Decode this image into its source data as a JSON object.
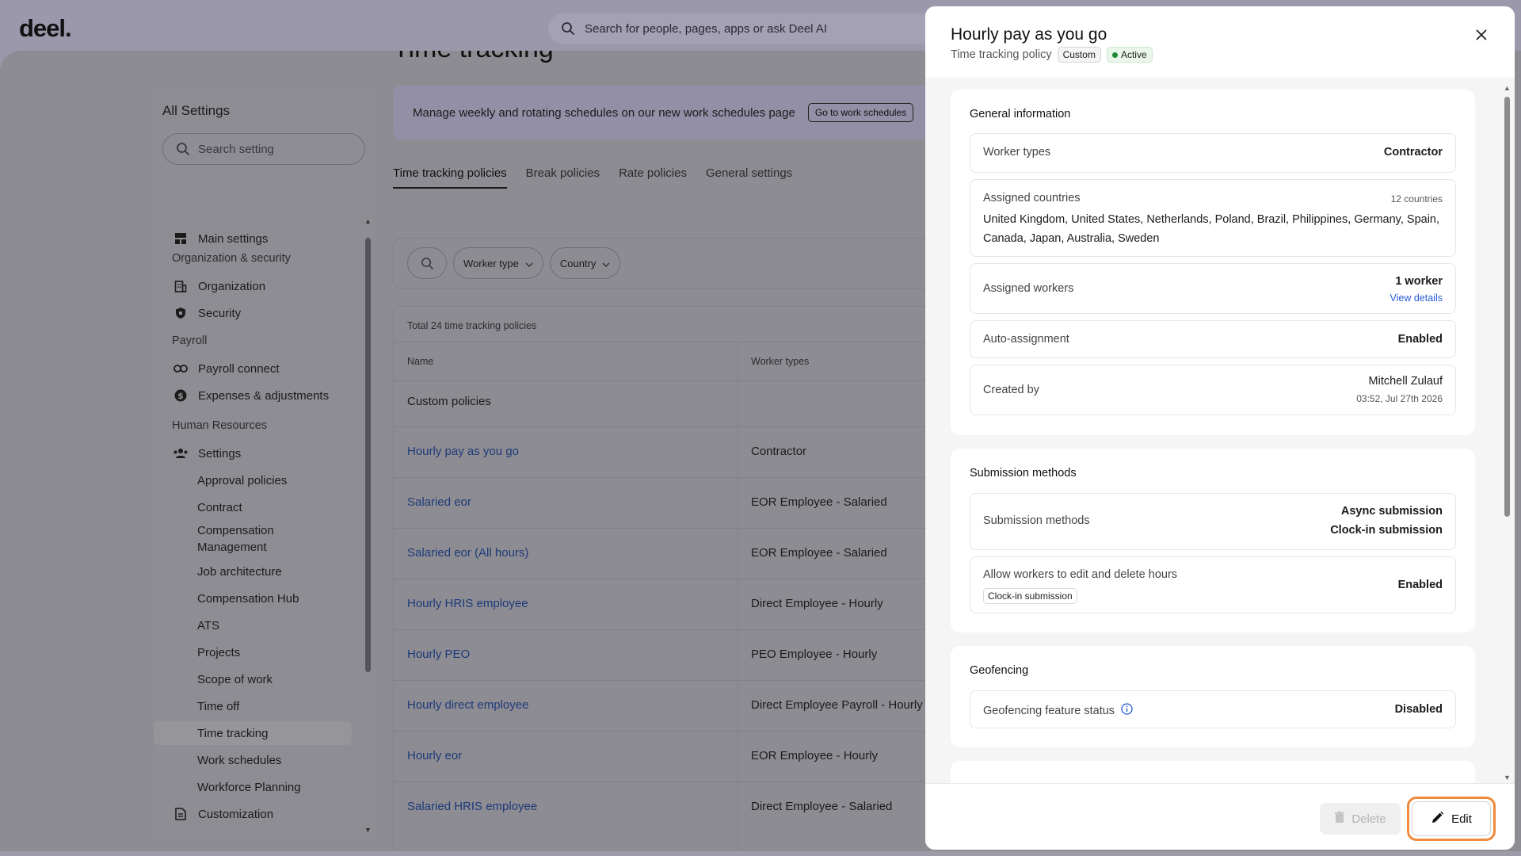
{
  "app": {
    "logo": "deel.",
    "search_placeholder": "Search for people, pages, apps or ask Deel AI"
  },
  "page": {
    "title": "Time tracking"
  },
  "sidebar": {
    "title": "All Settings",
    "search_placeholder": "Search setting",
    "main_settings": "Main settings",
    "sections": {
      "org_security": "Organization & security",
      "payroll": "Payroll",
      "hr": "Human Resources"
    },
    "items": {
      "organization": "Organization",
      "security": "Security",
      "payroll_connect": "Payroll connect",
      "expenses": "Expenses & adjustments",
      "settings": "Settings",
      "approval_policies": "Approval policies",
      "contract": "Contract",
      "compensation_management": "Compensation Management",
      "job_architecture": "Job architecture",
      "compensation_hub": "Compensation Hub",
      "ats": "ATS",
      "projects": "Projects",
      "scope_of_work": "Scope of work",
      "time_off": "Time off",
      "time_tracking": "Time tracking",
      "work_schedules": "Work schedules",
      "workforce_planning": "Workforce Planning",
      "customization": "Customization"
    }
  },
  "banner": {
    "text": "Manage weekly and rotating schedules on our new work schedules page",
    "button": "Go to work schedules"
  },
  "tabs": [
    "Time tracking policies",
    "Break policies",
    "Rate policies",
    "General settings"
  ],
  "filters": {
    "worker_type": "Worker type",
    "country": "Country"
  },
  "table": {
    "total": "Total 24 time tracking policies",
    "headers": {
      "name": "Name",
      "worker_types": "Worker types"
    },
    "group": "Custom policies",
    "rows": [
      {
        "name": "Hourly pay as you go",
        "worker_type": "Contractor"
      },
      {
        "name": "Salaried eor",
        "worker_type": "EOR Employee - Salaried"
      },
      {
        "name": "Salaried eor (All hours)",
        "worker_type": "EOR Employee - Salaried"
      },
      {
        "name": "Hourly HRIS employee",
        "worker_type": "Direct Employee - Hourly"
      },
      {
        "name": "Hourly PEO",
        "worker_type": "PEO Employee - Hourly"
      },
      {
        "name": "Hourly direct employee",
        "worker_type": "Direct Employee Payroll - Hourly"
      },
      {
        "name": "Hourly eor",
        "worker_type": "EOR Employee - Hourly"
      },
      {
        "name": "Salaried HRIS employee",
        "worker_type": "Direct Employee - Salaried"
      }
    ]
  },
  "panel": {
    "title": "Hourly pay as you go",
    "subtitle": "Time tracking policy",
    "tag_custom": "Custom",
    "tag_active": "Active",
    "general": {
      "heading": "General information",
      "worker_types_label": "Worker types",
      "worker_types_value": "Contractor",
      "countries_label": "Assigned countries",
      "countries_count": "12 countries",
      "countries_list": "United Kingdom, United States, Netherlands, Poland, Brazil, Philippines, Germany, Spain, Canada, Japan, Australia, Sweden",
      "workers_label": "Assigned workers",
      "workers_value": "1 worker",
      "workers_link": "View details",
      "auto_label": "Auto-assignment",
      "auto_value": "Enabled",
      "created_label": "Created by",
      "created_by": "Mitchell Zulauf",
      "created_at": "03:52, Jul 27th 2026"
    },
    "submission": {
      "heading": "Submission methods",
      "methods_label": "Submission methods",
      "method_1": "Async submission",
      "method_2": "Clock-in submission",
      "edit_label": "Allow workers to edit and delete hours",
      "edit_chip": "Clock-in submission",
      "edit_value": "Enabled"
    },
    "geofencing": {
      "heading": "Geofencing",
      "status_label": "Geofencing feature status",
      "status_value": "Disabled"
    },
    "footer": {
      "delete": "Delete",
      "edit": "Edit"
    }
  }
}
